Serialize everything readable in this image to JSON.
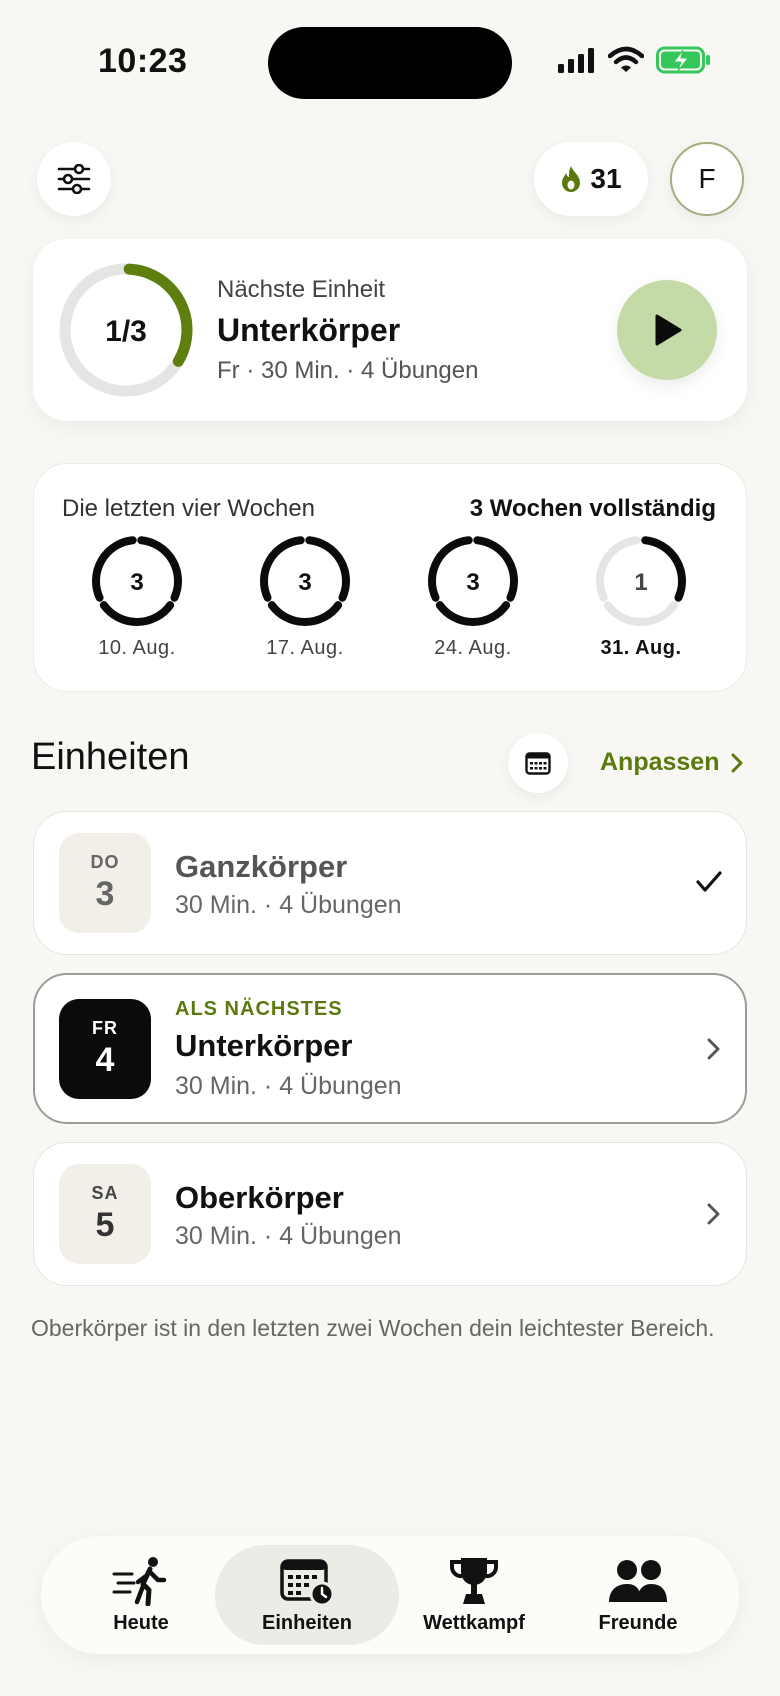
{
  "status_bar": {
    "time": "10:23"
  },
  "header": {
    "streak_count": "31",
    "avatar_initial": "F"
  },
  "next_session": {
    "progress_text": "1/3",
    "progress_fraction": 0.333,
    "label": "Nächste Einheit",
    "title": "Unterkörper",
    "meta": "Fr · 30 Min. · 4 Übungen"
  },
  "weeks": {
    "label": "Die letzten vier Wochen",
    "status": "3 Wochen vollständig",
    "items": [
      {
        "count": "3",
        "date": "10. Aug.",
        "completed": 3,
        "total": 3
      },
      {
        "count": "3",
        "date": "17. Aug.",
        "completed": 3,
        "total": 3
      },
      {
        "count": "3",
        "date": "24. Aug.",
        "completed": 3,
        "total": 3
      },
      {
        "count": "1",
        "date": "31. Aug.",
        "completed": 1,
        "total": 3
      }
    ]
  },
  "units": {
    "title": "Einheiten",
    "adjust_label": "Anpassen",
    "items": [
      {
        "dow": "DO",
        "day": "3",
        "title": "Ganzkörper",
        "meta": "30 Min. · 4 Übungen",
        "badge": ""
      },
      {
        "dow": "FR",
        "day": "4",
        "title": "Unterkörper",
        "meta": "30 Min. · 4 Übungen",
        "badge": "ALS NÄCHSTES"
      },
      {
        "dow": "SA",
        "day": "5",
        "title": "Oberkörper",
        "meta": "30 Min. · 4 Übungen",
        "badge": ""
      }
    ],
    "hint": "Oberkörper ist in den letzten zwei Wochen dein leichtester Bereich."
  },
  "tabbar": {
    "tabs": [
      {
        "label": "Heute",
        "icon": "walking-person-icon"
      },
      {
        "label": "Einheiten",
        "icon": "calendar-clock-icon"
      },
      {
        "label": "Wettkampf",
        "icon": "trophy-icon"
      },
      {
        "label": "Freunde",
        "icon": "people-icon"
      }
    ],
    "active_tab": "Einheiten"
  },
  "colors": {
    "background": "#f8f7f3",
    "accent_green": "#5a7a0d",
    "ring_green": "#5e7f0f",
    "play_green": "#c5dba7"
  }
}
